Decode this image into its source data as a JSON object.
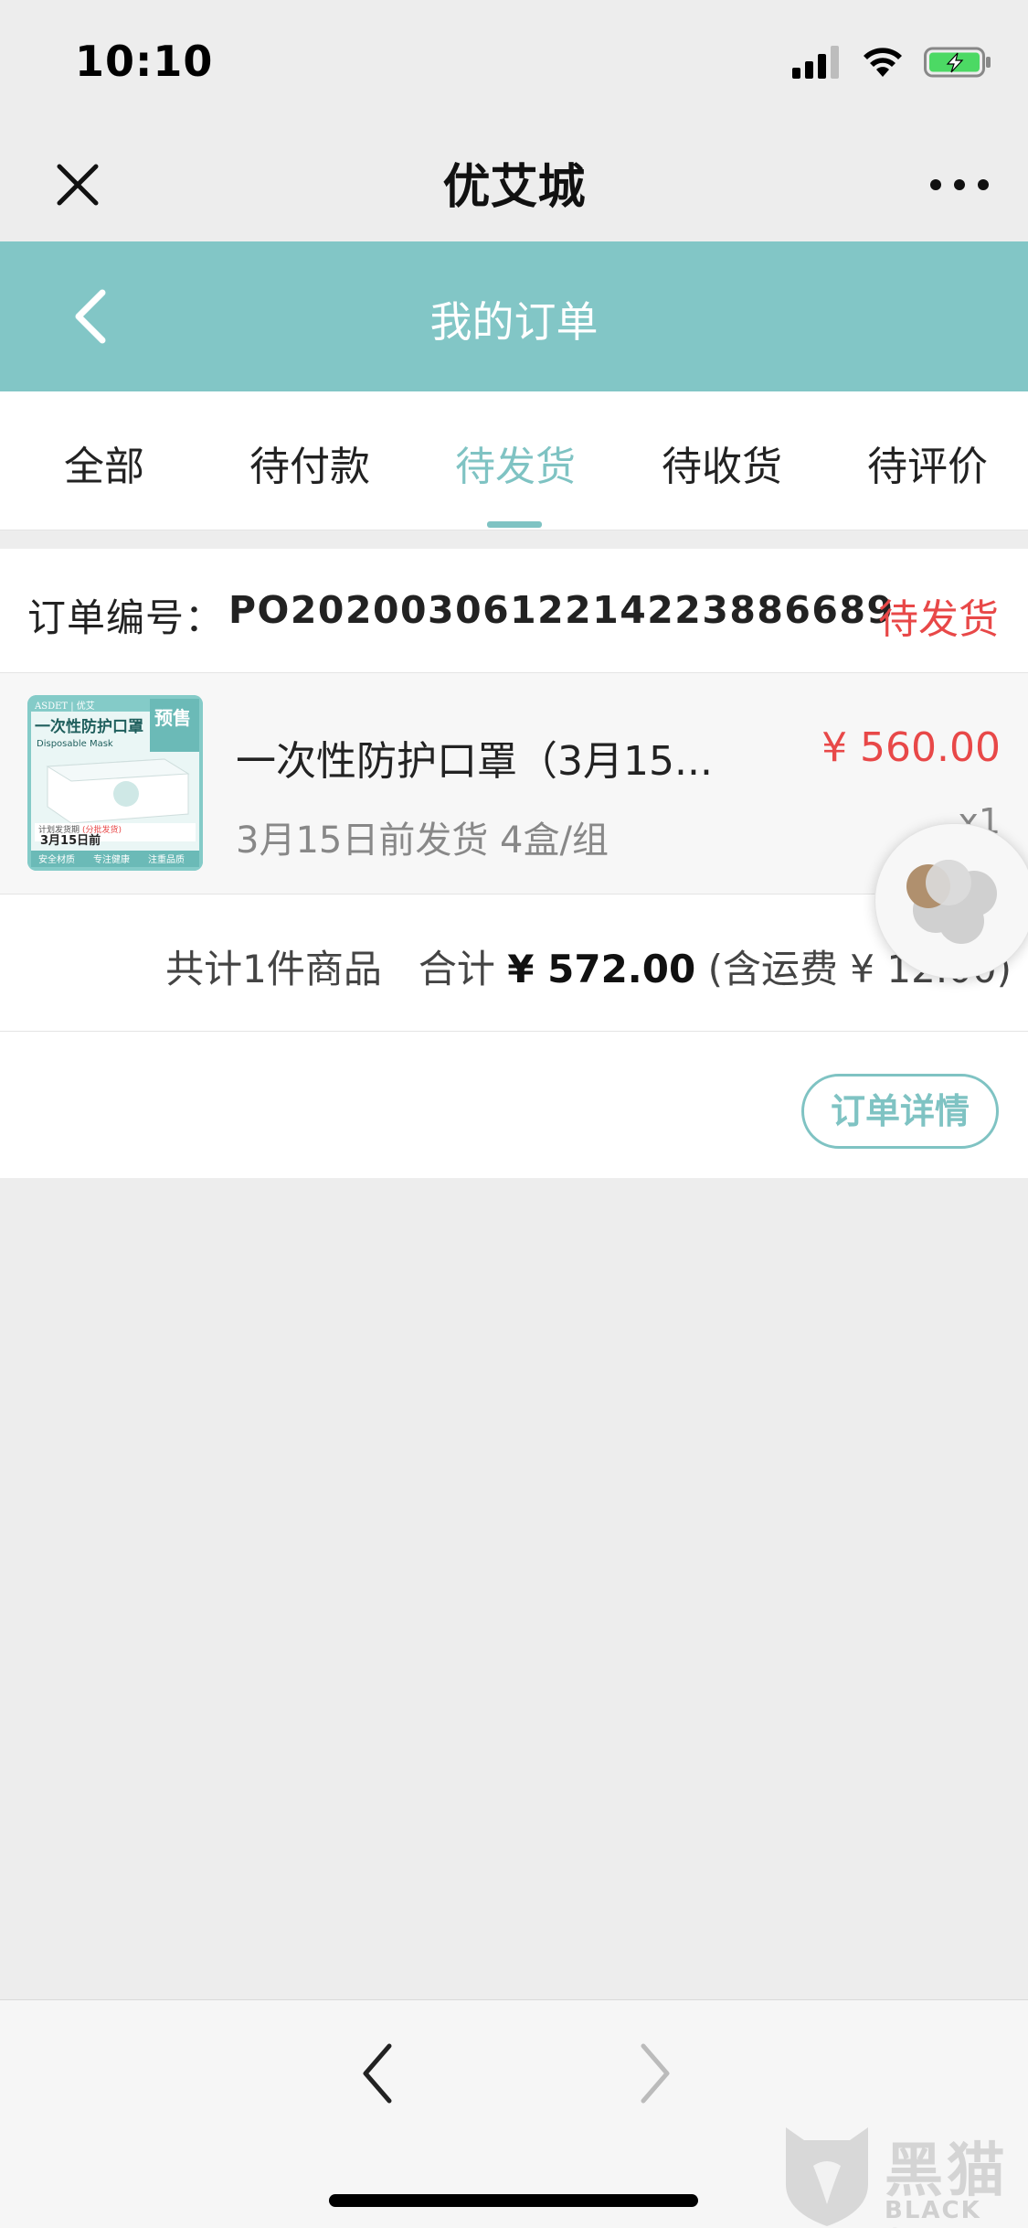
{
  "status_bar": {
    "time": "10:10"
  },
  "title_bar": {
    "title": "优艾城"
  },
  "header": {
    "title": "我的订单"
  },
  "tabs": [
    {
      "label": "全部",
      "active": false
    },
    {
      "label": "待付款",
      "active": false
    },
    {
      "label": "待发货",
      "active": true
    },
    {
      "label": "待收货",
      "active": false
    },
    {
      "label": "待评价",
      "active": false
    }
  ],
  "order": {
    "number_label": "订单编号：",
    "number": "PO20200306122142238866​89",
    "status": "待发货",
    "item": {
      "name": "一次性防护口罩（3月15...",
      "desc": "3月15日前发货 4盒/组",
      "price": "¥ 560.00",
      "qty": "x1",
      "thumb": {
        "brand": "ASDET | 优艾",
        "title": "一次性防护口罩",
        "subtitle": "Disposable Mask",
        "badge": "预售",
        "ship_note": "计划发货期",
        "batch_note": "(分批发货)",
        "date": "3月15日前",
        "tags": [
          "安全材质",
          "专注健康",
          "注重品质"
        ]
      }
    },
    "total_count": "共计1件商品",
    "total_label": "合计",
    "total_amount": "¥ 572.00",
    "shipping_note": "(含运费 ¥ 12.00)",
    "detail_button": "订单详情"
  },
  "watermark": {
    "cn": "黑猫",
    "en": "BLACK CAT"
  },
  "colors": {
    "accent": "#82c6c6",
    "price_red": "#e84848",
    "background": "#ededed"
  }
}
